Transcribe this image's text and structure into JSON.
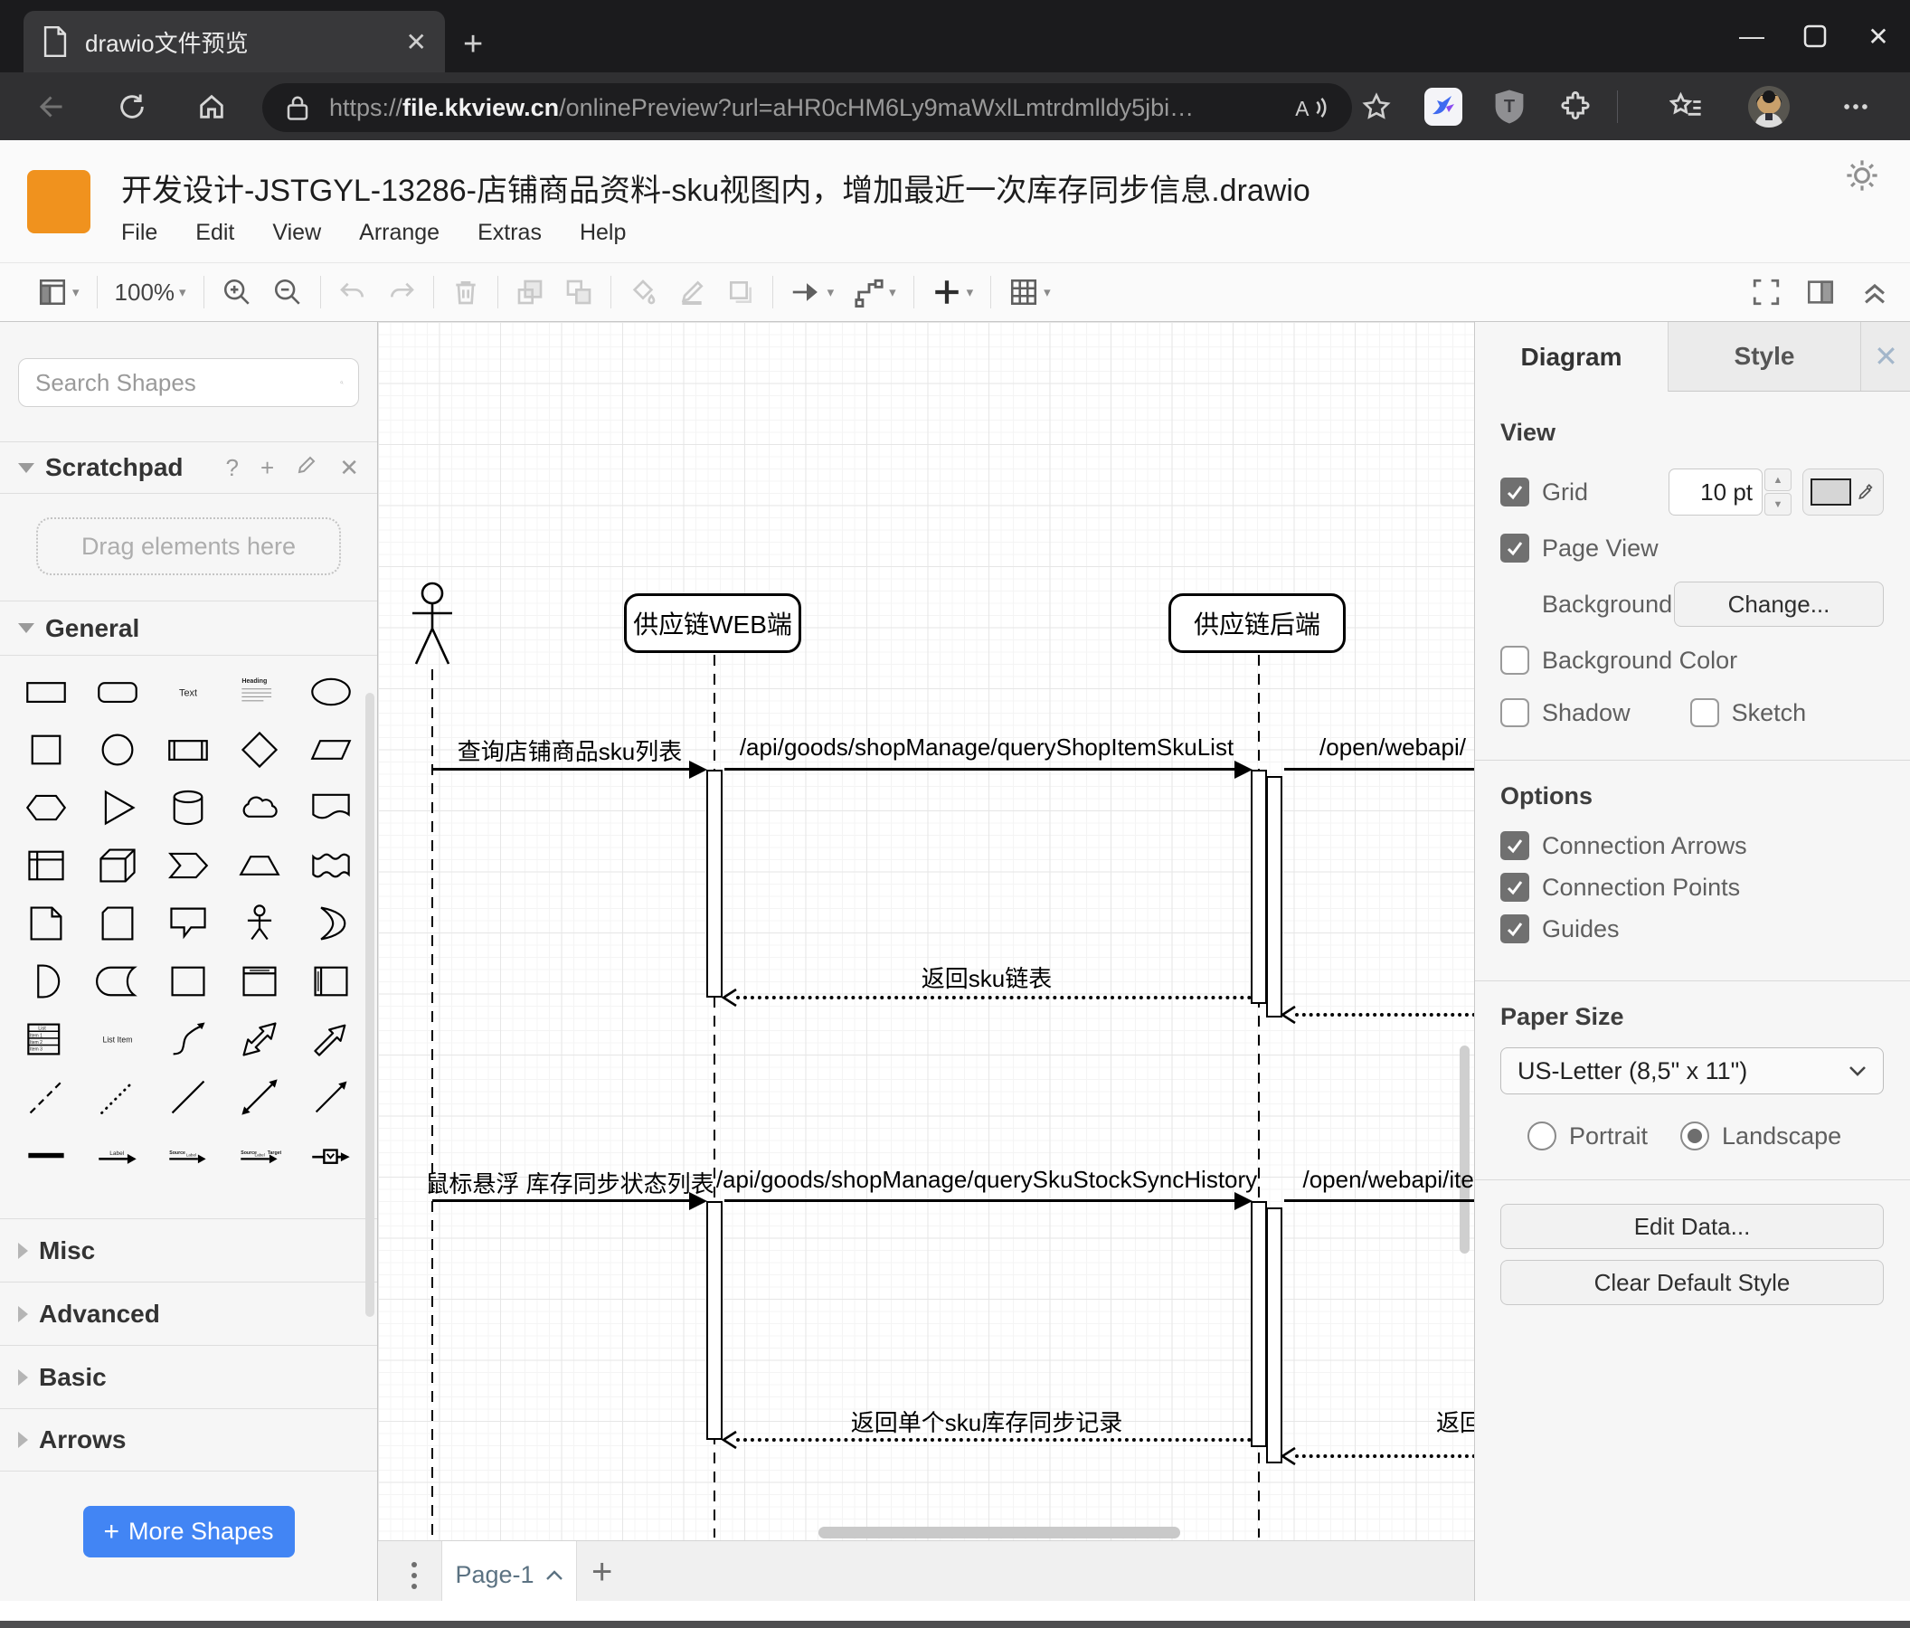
{
  "browser": {
    "tab_title": "drawio文件预览",
    "url_scheme": "https://",
    "url_domain": "file.kkview.cn",
    "url_path": "/onlinePreview?url=aHR0cHM6Ly9maWxlLmtrdmlldy5jbi…"
  },
  "header": {
    "title": "开发设计-JSTGYL-13286-店铺商品资料-sku视图内，增加最近一次库存同步信息.drawio",
    "menus": [
      "File",
      "Edit",
      "View",
      "Arrange",
      "Extras",
      "Help"
    ]
  },
  "toolbar": {
    "zoom_level": "100%"
  },
  "sidebar": {
    "search_placeholder": "Search Shapes",
    "scratchpad_title": "Scratchpad",
    "scratchpad_help": "?",
    "drag_hint": "Drag elements here",
    "sections": [
      "General",
      "Misc",
      "Advanced",
      "Basic",
      "Arrows"
    ],
    "more_shapes_label": "More Shapes",
    "shape_texts": {
      "text": "Text",
      "heading": "Heading",
      "list_title": "List",
      "list_items": [
        "Item 1",
        "Item 2",
        "Item 3"
      ],
      "list_item": "List Item",
      "label": "Label",
      "source": "Source",
      "target": "Target"
    },
    "shapes": [
      "rectangle",
      "rounded-rectangle",
      "text",
      "textbox-heading",
      "ellipse",
      "square",
      "circle",
      "process",
      "diamond",
      "parallelogram",
      "hexagon",
      "triangle",
      "cylinder",
      "cloud",
      "document",
      "internal-storage",
      "cube",
      "step",
      "trapezoid",
      "tape",
      "note",
      "card",
      "callout",
      "actor",
      "or",
      "and",
      "data-storage",
      "container",
      "vertical-container",
      "horizontal-container",
      "list",
      "list-item",
      "curve",
      "bidirectional-arrow",
      "arrow",
      "dashed-line",
      "dotted-line",
      "line",
      "bidirectional-connector",
      "directional-connector",
      "link",
      "arrow-with-label",
      "arrow-source-label",
      "arrow-source-target",
      "arrow-with-box"
    ]
  },
  "diagram": {
    "participant_web": "供应链WEB端",
    "participant_backend": "供应链后端",
    "msg1": "查询店铺商品sku列表",
    "msg1_api": "/api/goods/shopManage/queryShopItemSkuList",
    "msg1_open": "/open/webapi/",
    "ret1": "返回sku链表",
    "msg2": "鼠标悬浮 库存同步状态列表",
    "msg2_api": "/api/goods/shopManage/querySkuStockSyncHistory",
    "msg2_open": "/open/webapi/item",
    "ret2": "返回单个sku库存同步记录",
    "ret2_edge": "返回"
  },
  "footer": {
    "page_tab": "Page-1"
  },
  "panel": {
    "tab_diagram": "Diagram",
    "tab_style": "Style",
    "view_heading": "View",
    "grid_label": "Grid",
    "grid_size": "10 pt",
    "page_view_label": "Page View",
    "background_label": "Background",
    "change_button": "Change...",
    "background_color_label": "Background Color",
    "shadow_label": "Shadow",
    "sketch_label": "Sketch",
    "options_heading": "Options",
    "option_connection_arrows": "Connection Arrows",
    "option_connection_points": "Connection Points",
    "option_guides": "Guides",
    "paper_heading": "Paper Size",
    "paper_size_value": "US-Letter (8,5\" x 11\")",
    "portrait_label": "Portrait",
    "landscape_label": "Landscape",
    "edit_data_button": "Edit Data...",
    "clear_style_button": "Clear Default Style"
  },
  "colors": {
    "logo_orange": "#f0921e",
    "more_shapes_blue": "#4285f4",
    "page_tab_text": "#5b7282",
    "checked_gray": "#707070"
  }
}
